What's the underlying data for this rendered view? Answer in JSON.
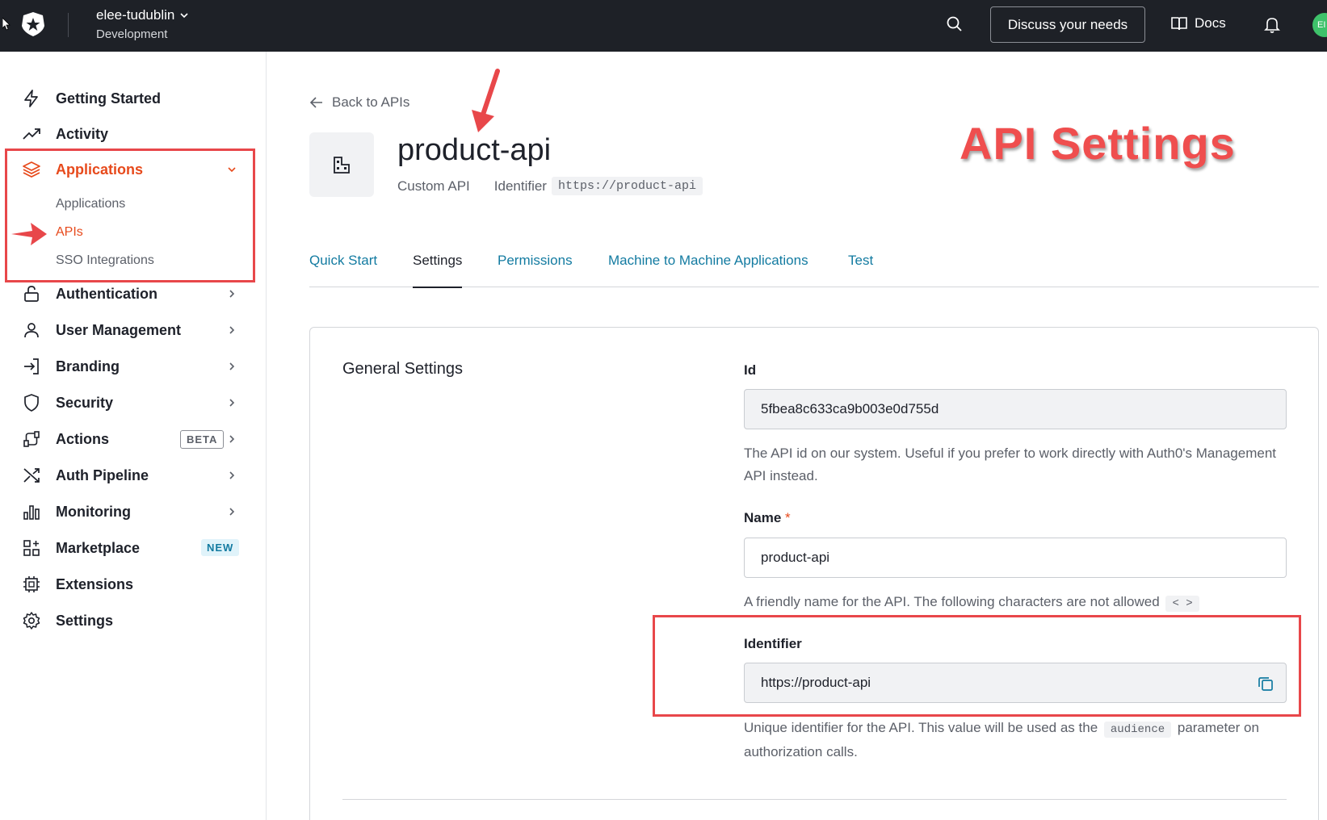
{
  "topbar": {
    "tenant_name": "elee-tudublin",
    "tenant_env": "Development",
    "discuss_label": "Discuss your needs",
    "docs_label": "Docs",
    "avatar_initials": "EI"
  },
  "sidebar": {
    "items": [
      {
        "label": "Getting Started",
        "icon": "bolt-icon"
      },
      {
        "label": "Activity",
        "icon": "trending-up-icon"
      },
      {
        "label": "Applications",
        "icon": "layers-icon"
      },
      {
        "label": "Authentication",
        "icon": "lock-icon"
      },
      {
        "label": "User Management",
        "icon": "user-icon"
      },
      {
        "label": "Branding",
        "icon": "sign-in-icon"
      },
      {
        "label": "Security",
        "icon": "shield-icon"
      },
      {
        "label": "Actions",
        "icon": "flow-icon"
      },
      {
        "label": "Auth Pipeline",
        "icon": "shuffle-icon"
      },
      {
        "label": "Monitoring",
        "icon": "bar-chart-icon"
      },
      {
        "label": "Marketplace",
        "icon": "grid-plus-icon"
      },
      {
        "label": "Extensions",
        "icon": "chip-icon"
      },
      {
        "label": "Settings",
        "icon": "gear-icon"
      }
    ],
    "applications_sub": [
      "Applications",
      "APIs",
      "SSO Integrations"
    ],
    "beta_badge": "BETA",
    "new_badge": "NEW"
  },
  "main": {
    "back_label": "Back to APIs",
    "api_name": "product-api",
    "api_type": "Custom API",
    "identifier_label": "Identifier",
    "identifier_value": "https://product-api",
    "tabs": [
      "Quick Start",
      "Settings",
      "Permissions",
      "Machine to Machine Applications",
      "Test"
    ],
    "active_tab": "Settings"
  },
  "general_settings": {
    "title": "General Settings",
    "id_label": "Id",
    "id_value": "5fbea8c633ca9b003e0d755d",
    "id_help": "The API id on our system. Useful if you prefer to work directly with Auth0's Management API instead.",
    "name_label": "Name",
    "name_required": "*",
    "name_value": "product-api",
    "name_help": "A friendly name for the API. The following characters are not allowed",
    "name_help_code": "< >",
    "identifier_label": "Identifier",
    "identifier_value": "https://product-api",
    "identifier_help_before": "Unique identifier for the API. This value will be used as the",
    "identifier_help_code": "audience",
    "identifier_help_after": "parameter on authorization calls."
  },
  "annotation": {
    "title": "API Settings"
  },
  "colors": {
    "topbar_bg": "#1e2127",
    "accent_orange": "#e74a1c",
    "link_blue": "#137ba1",
    "annotation_red": "#e8474a"
  }
}
